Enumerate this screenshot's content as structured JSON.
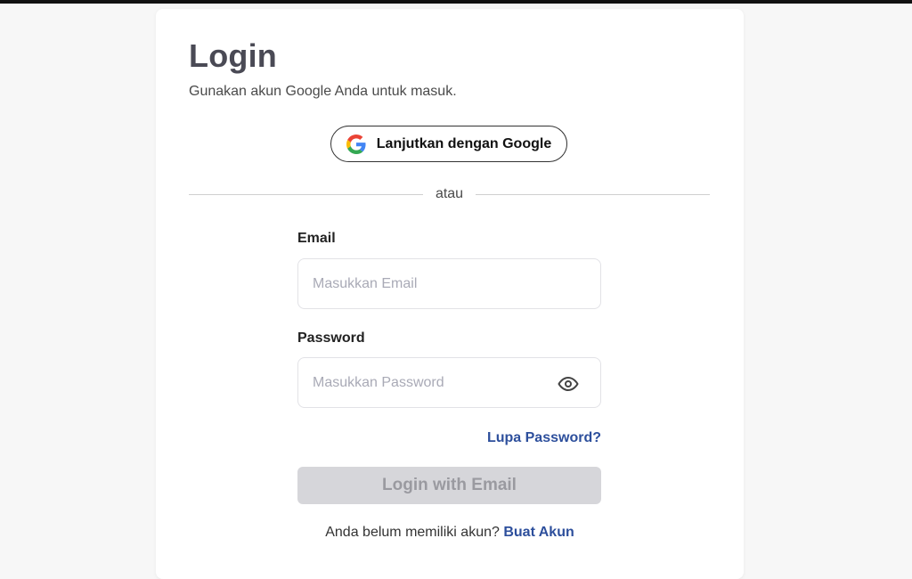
{
  "page": {
    "title": "Login",
    "subtitle": "Gunakan akun Google Anda untuk masuk."
  },
  "google_button": {
    "label": "Lanjutkan dengan Google",
    "icon": "google-g-icon"
  },
  "divider": {
    "text": "atau"
  },
  "email": {
    "label": "Email",
    "placeholder": "Masukkan Email",
    "value": ""
  },
  "password": {
    "label": "Password",
    "placeholder": "Masukkan Password",
    "value": "",
    "toggle_icon": "eye-icon"
  },
  "forgot_password": {
    "label": "Lupa Password?"
  },
  "login_button": {
    "label": "Login with Email",
    "disabled": true
  },
  "signup": {
    "prompt": "Anda belum memiliki akun?",
    "link_label": "Buat Akun"
  },
  "colors": {
    "link": "#2d4f9c",
    "title": "#4a4a55",
    "button_disabled_bg": "#d6d6da",
    "button_disabled_text": "#9a9aa0",
    "page_bg": "#f7f7f7",
    "card_bg": "#ffffff"
  }
}
